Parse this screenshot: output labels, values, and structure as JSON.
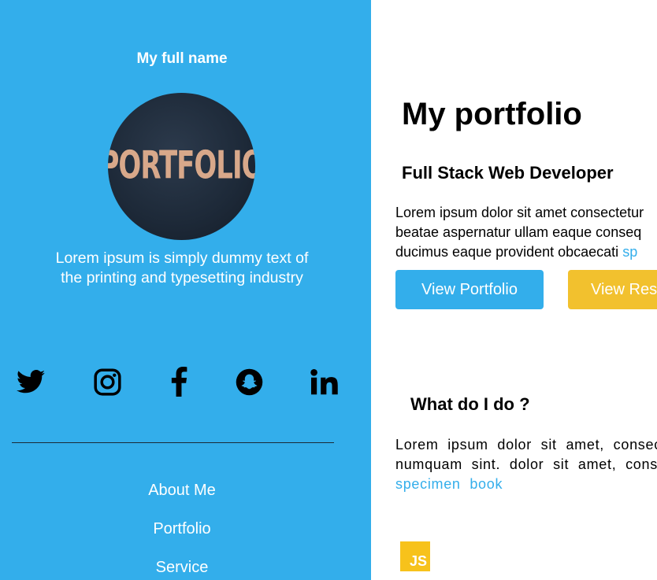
{
  "sidebar": {
    "name": "My full name",
    "avatar_text": "PORTFOLIO",
    "tagline_line1": "Lorem ipsum is simply dummy text of",
    "tagline_line2": "the printing and typesetting industry",
    "social_icons": [
      "twitter-icon",
      "instagram-icon",
      "facebook-icon",
      "snapchat-icon",
      "linkedin-icon"
    ],
    "nav": [
      "About Me",
      "Portfolio",
      "Service"
    ]
  },
  "main": {
    "title": "My portfolio",
    "subtitle": "Full Stack Web Developer",
    "intro_line1": "Lorem ipsum dolor sit amet consectetur",
    "intro_line2": "beatae aspernatur ullam eaque conseq",
    "intro_line3": "ducimus eaque provident obcaecati ",
    "intro_link": "sp",
    "btn_portfolio": "View Portfolio",
    "btn_resume": "View Res",
    "whatdo_title": "What do I do ?",
    "body_line1": "Lorem ipsum dolor sit amet, consec",
    "body_line2": "numquam sint. dolor sit amet, conse",
    "body_link": "specimen book",
    "js_badge": "JS"
  },
  "colors": {
    "sidebar_bg": "#33aeeb",
    "accent": "#33aeeb",
    "resume_button": "#f2c12e",
    "js_badge": "#f7c21b"
  }
}
